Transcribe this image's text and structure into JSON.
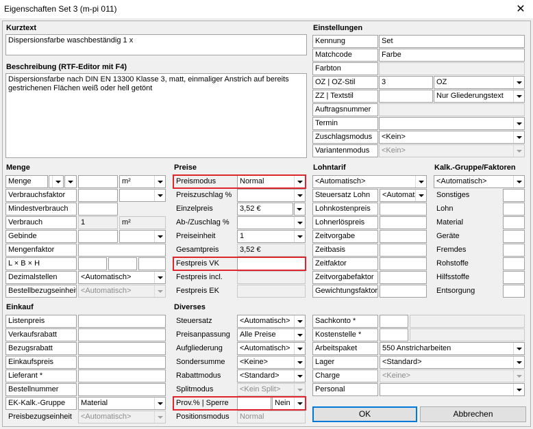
{
  "window": {
    "title": "Eigenschaften Set 3 (m-pi 011)",
    "close": "✕"
  },
  "kurztext": {
    "label": "Kurztext",
    "value": "Dispersionsfarbe waschbeständig 1 x"
  },
  "beschreibung": {
    "label": "Beschreibung (RTF-Editor mit F4)",
    "value": "Dispersionsfarbe nach DIN EN 13300 Klasse 3, matt, einmaliger Anstrich auf bereits\ngestrichenen Flächen weiß oder hell getönt"
  },
  "einstellungen": {
    "label": "Einstellungen",
    "kennung": {
      "label": "Kennung",
      "value": "Set"
    },
    "matchcode": {
      "label": "Matchcode",
      "value": "Farbe"
    },
    "farbton": {
      "label": "Farbton",
      "value": ""
    },
    "oz": {
      "label": "OZ | OZ-Stil",
      "value": "3",
      "select": "OZ"
    },
    "zz": {
      "label": "ZZ | Textstil",
      "value": "",
      "select": "Nur Gliederungstext"
    },
    "auftragsnummer": {
      "label": "Auftragsnummer",
      "value": ""
    },
    "termin": {
      "label": "Termin",
      "value": ""
    },
    "zuschlagsmodus": {
      "label": "Zuschlagsmodus",
      "value": "<Kein>"
    },
    "variantenmodus": {
      "label": "Variantenmodus",
      "value": "<Kein>"
    }
  },
  "menge": {
    "label": "Menge",
    "rows": {
      "menge": {
        "label": "Menge",
        "value": "",
        "unit": "m²"
      },
      "verbrauchsfaktor": {
        "label": "Verbrauchsfaktor"
      },
      "mindestverbrauch": {
        "label": "Mindestverbrauch"
      },
      "verbrauch": {
        "label": "Verbrauch",
        "value": "1",
        "unit": "m²"
      },
      "gebinde": {
        "label": "Gebinde"
      },
      "mengenfaktor": {
        "label": "Mengenfaktor"
      },
      "lbh": {
        "label": "L × B × H"
      },
      "dezimalstellen": {
        "label": "Dezimalstellen",
        "value": "<Automatisch>"
      },
      "bestellbezugseinheit": {
        "label": "Bestellbezugseinheit",
        "value": "<Automatisch>"
      }
    }
  },
  "preise": {
    "label": "Preise",
    "preismodus": {
      "label": "Preismodus",
      "value": "Normal"
    },
    "preiszuschlag": {
      "label": "Preiszuschlag %",
      "value": ""
    },
    "einzelpreis": {
      "label": "Einzelpreis",
      "value": "3,52 €"
    },
    "abzuschlag": {
      "label": "Ab-/Zuschlag %",
      "value": ""
    },
    "preiseinheit": {
      "label": "Preiseinheit",
      "value": "1"
    },
    "gesamtpreis": {
      "label": "Gesamtpreis",
      "value": "3,52 €"
    },
    "festpreis_vk": {
      "label": "Festpreis VK",
      "value": ""
    },
    "festpreis_incl": {
      "label": "Festpreis incl.",
      "value": ""
    },
    "festpreis_ek": {
      "label": "Festpreis EK",
      "value": ""
    }
  },
  "lohntarif": {
    "label": "Lohntarif",
    "select": "<Automatisch>",
    "steuersatz": {
      "label": "Steuersatz Lohn",
      "value": "<Automat"
    },
    "rows": [
      "Lohnkostenpreis",
      "Lohnerlöspreis",
      "Zeitvorgabe",
      "Zeitbasis",
      "Zeitfaktor",
      "Zeitvorgabefaktor",
      "Gewichtungsfaktor"
    ]
  },
  "kalk": {
    "label": "Kalk.-Gruppe/Faktoren",
    "select": "<Automatisch>",
    "rows": [
      "Sonstiges",
      "Lohn",
      "Material",
      "Geräte",
      "Fremdes",
      "Rohstoffe",
      "Hilfsstoffe",
      "Entsorgung"
    ]
  },
  "einkauf": {
    "label": "Einkauf",
    "rows": [
      "Listenpreis",
      "Verkaufsrabatt",
      "Bezugsrabatt",
      "Einkaufspreis",
      "Lieferant *",
      "Bestellnummer"
    ],
    "ek_gruppe": {
      "label": "EK-Kalk.-Gruppe",
      "value": "Material"
    },
    "preisbezug": {
      "label": "Preisbezugseinheit",
      "value": "<Automatisch>"
    }
  },
  "diverses": {
    "label": "Diverses",
    "steuersatz": {
      "label": "Steuersatz",
      "value": "<Automatisch>"
    },
    "preisanpassung": {
      "label": "Preisanpassung",
      "value": "Alle Preise"
    },
    "aufgliederung": {
      "label": "Aufgliederung",
      "value": "<Automatisch>"
    },
    "sondersumme": {
      "label": "Sondersumme",
      "value": "<Keine>"
    },
    "rabattmodus": {
      "label": "Rabattmodus",
      "value": "<Standard>"
    },
    "splitmodus": {
      "label": "Splitmodus",
      "value": "<Kein Split>"
    },
    "prov": {
      "label": "Prov.% | Sperre",
      "value": "",
      "select": "Nein"
    },
    "positionsmodus": {
      "label": "Positionsmodus",
      "value": "Normal"
    }
  },
  "konten": {
    "sachkonto": {
      "label": "Sachkonto *"
    },
    "kostenstelle": {
      "label": "Kostenstelle *"
    },
    "arbeitspaket": {
      "label": "Arbeitspaket",
      "value": "550 Anstricharbeiten"
    },
    "lager": {
      "label": "Lager",
      "value": "<Standard>"
    },
    "charge": {
      "label": "Charge",
      "value": "<Keine>"
    },
    "personal": {
      "label": "Personal",
      "value": ""
    }
  },
  "buttons": {
    "ok": "OK",
    "abbrechen": "Abbrechen"
  },
  "colors": {
    "highlight": "#e0242e",
    "default_button": "#0078d7"
  }
}
